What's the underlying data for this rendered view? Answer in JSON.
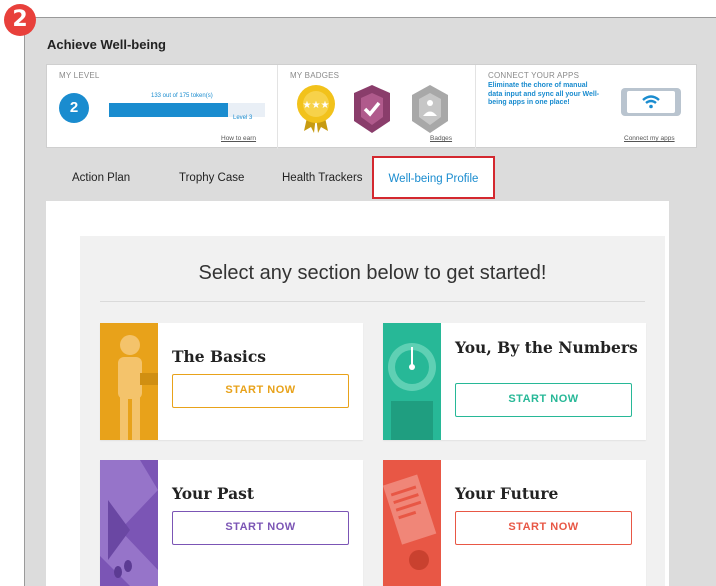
{
  "step_number": "2",
  "app": {
    "title": "Achieve Well-being"
  },
  "level": {
    "heading": "MY LEVEL",
    "value": "2",
    "tokens_text": "133 out of 175 token(s)",
    "progress_fraction": 0.76,
    "next_level_label": "Level 3",
    "link": "How to earn"
  },
  "badges": {
    "heading": "MY BADGES",
    "items": [
      {
        "icon": "stars-medal-icon",
        "color": "#f2c21b"
      },
      {
        "icon": "check-shield-icon",
        "color": "#8a3d6b"
      },
      {
        "icon": "meditation-badge-icon",
        "color": "#a8a8a8"
      }
    ],
    "link": "Badges"
  },
  "apps": {
    "heading": "CONNECT YOUR APPS",
    "text": "Eliminate the chore of manual data input and sync all your Well-being apps in one place!",
    "icon": "phone-wifi-icon",
    "link": "Connect my apps"
  },
  "tabs": [
    {
      "label": "Action Plan",
      "active": false
    },
    {
      "label": "Trophy Case",
      "active": false
    },
    {
      "label": "Health Trackers",
      "active": false
    },
    {
      "label": "Well-being Profile",
      "active": true
    }
  ],
  "main": {
    "intro": "Select any section below to get started!",
    "cards": [
      {
        "title": "The Basics",
        "button": "START NOW",
        "color": "#e8a21a",
        "icon": "person-icon"
      },
      {
        "title": "You, By the Numbers",
        "button": "START NOW",
        "color": "#27b897",
        "icon": "scale-icon"
      },
      {
        "title": "Your Past",
        "button": "START NOW",
        "color": "#7b55b5",
        "icon": "path-icon"
      },
      {
        "title": "Your Future",
        "button": "START NOW",
        "color": "#e85745",
        "icon": "document-icon"
      }
    ]
  },
  "colors": {
    "accent": "#1a8ccf",
    "highlight": "#d4282f",
    "marker": "#e8403b"
  }
}
